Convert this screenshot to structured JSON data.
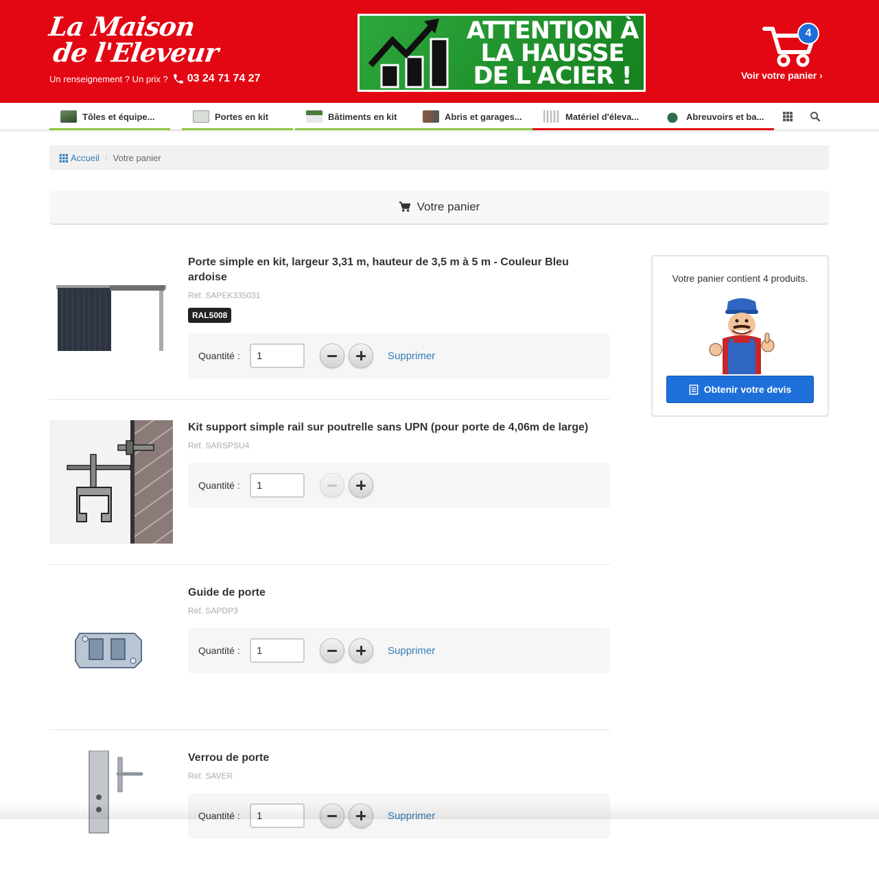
{
  "header": {
    "logo_line1": "La Maison",
    "logo_line2": "de l'Eleveur",
    "contact_text": "Un renseignement ? Un prix ?",
    "phone": "03 24 71 74 27",
    "banner_line1": "ATTENTION À",
    "banner_line2": "LA HAUSSE",
    "banner_line3": "DE L'ACIER !",
    "cart_count": "4",
    "cart_link": "Voir votre panier"
  },
  "nav": {
    "items": [
      {
        "label": "Tôles et équipe...",
        "color": "#8cc63f"
      },
      {
        "label": "Portes en kit",
        "color": "#8cc63f"
      },
      {
        "label": "Bâtiments en kit",
        "color": "#8cc63f"
      },
      {
        "label": "Abris et garages...",
        "color": "#8cc63f"
      },
      {
        "label": "Matériel d'éleva...",
        "color": "#e30613"
      },
      {
        "label": "Abreuvoirs et ba...",
        "color": "#e30613"
      }
    ],
    "grid_icon": "grid-icon",
    "search_icon": "search-icon"
  },
  "breadcrumb": {
    "home": "Accueil",
    "separator": "/",
    "current": "Votre panier"
  },
  "page_title": "Votre panier",
  "items": [
    {
      "title": "Porte simple en kit, largeur 3,31 m, hauteur de 3,5 m à 5 m - Couleur Bleu ardoise",
      "ref": "Réf. SAPEK335031",
      "tag": "RAL5008",
      "qty_label": "Quantité :",
      "qty": "1",
      "delete": "Supprimer"
    },
    {
      "title": "Kit support simple rail sur poutrelle sans UPN (pour porte de 4,06m de large)",
      "ref": "Réf. SARSPSU4",
      "qty_label": "Quantité :",
      "qty": "1",
      "minus_disabled": true
    },
    {
      "title": "Guide de porte",
      "ref": "Réf. SAPDP3",
      "qty_label": "Quantité :",
      "qty": "1",
      "delete": "Supprimer"
    },
    {
      "title": "Verrou de porte",
      "ref": "Réf. SAVER",
      "qty_label": "Quantité :",
      "qty": "1",
      "delete": "Supprimer"
    }
  ],
  "sidebar": {
    "summary": "Votre panier contient 4 produits.",
    "button": "Obtenir votre devis"
  },
  "colors": {
    "brand_red": "#e30613",
    "link_blue": "#337ab7",
    "button_blue": "#1e6fd9"
  }
}
